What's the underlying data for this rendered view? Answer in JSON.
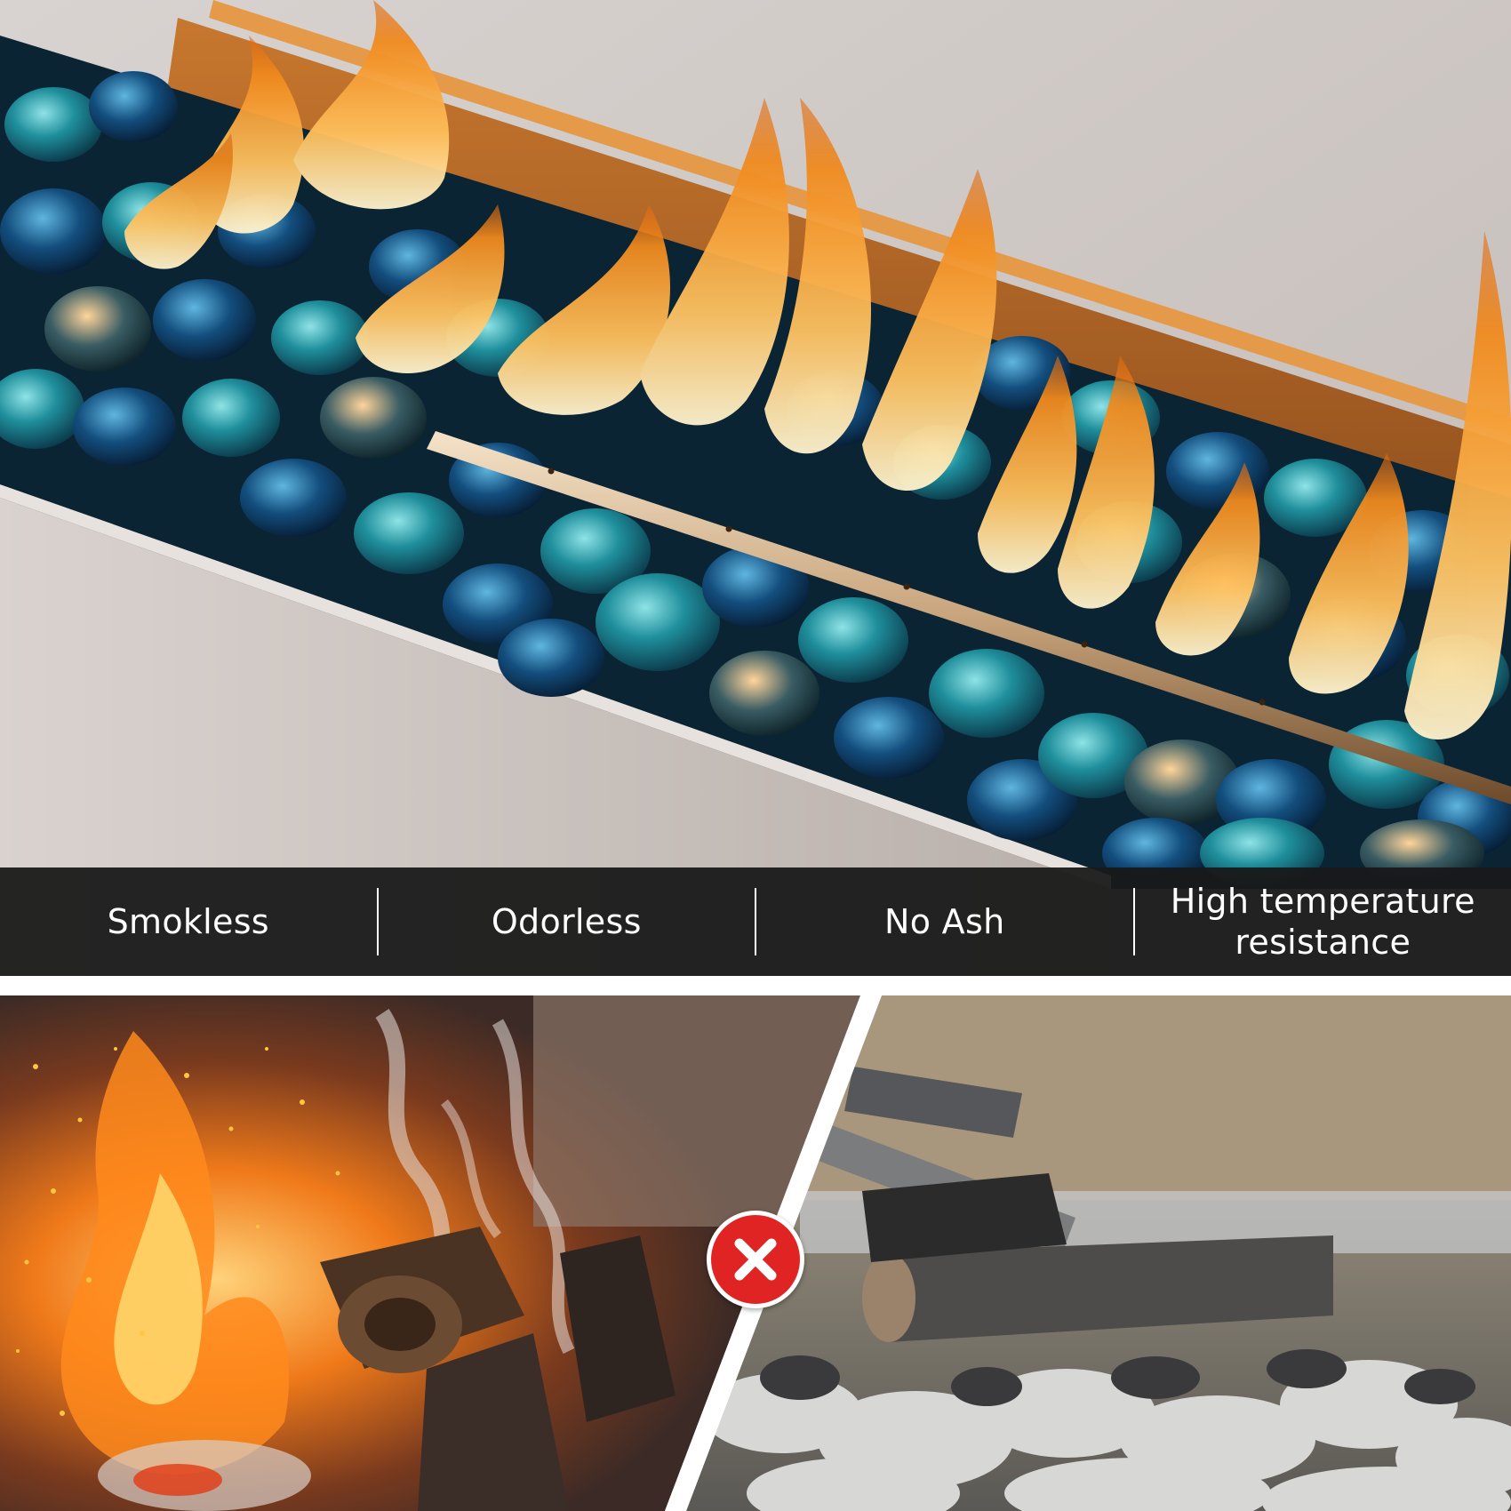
{
  "features": [
    {
      "label": "Smokless"
    },
    {
      "label": "Odorless"
    },
    {
      "label": "No Ash"
    },
    {
      "label": "High temperature resistance"
    }
  ],
  "icons": {
    "comparison_marker": "x-circle-icon"
  },
  "colors": {
    "bar_background": "#181818",
    "bar_text": "#ffffff",
    "x_badge": "#e02424",
    "frame_orange": "#d98a3a",
    "glass_teal": "#2aa3b0",
    "glass_blue": "#0f3f6e"
  }
}
